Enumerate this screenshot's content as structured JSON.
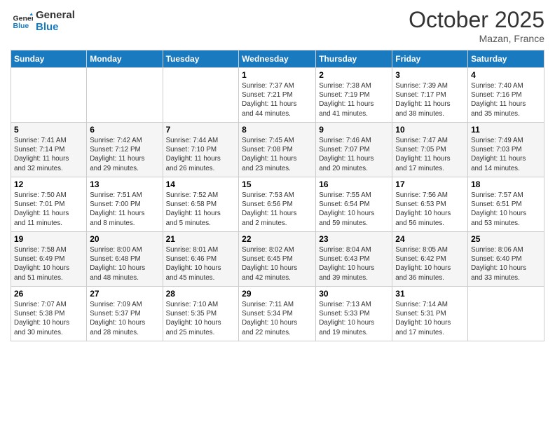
{
  "header": {
    "logo": {
      "line1": "General",
      "line2": "Blue"
    },
    "title": "October 2025",
    "location": "Mazan, France"
  },
  "weekdays": [
    "Sunday",
    "Monday",
    "Tuesday",
    "Wednesday",
    "Thursday",
    "Friday",
    "Saturday"
  ],
  "weeks": [
    [
      {
        "day": "",
        "info": ""
      },
      {
        "day": "",
        "info": ""
      },
      {
        "day": "",
        "info": ""
      },
      {
        "day": "1",
        "info": "Sunrise: 7:37 AM\nSunset: 7:21 PM\nDaylight: 11 hours\nand 44 minutes."
      },
      {
        "day": "2",
        "info": "Sunrise: 7:38 AM\nSunset: 7:19 PM\nDaylight: 11 hours\nand 41 minutes."
      },
      {
        "day": "3",
        "info": "Sunrise: 7:39 AM\nSunset: 7:17 PM\nDaylight: 11 hours\nand 38 minutes."
      },
      {
        "day": "4",
        "info": "Sunrise: 7:40 AM\nSunset: 7:16 PM\nDaylight: 11 hours\nand 35 minutes."
      }
    ],
    [
      {
        "day": "5",
        "info": "Sunrise: 7:41 AM\nSunset: 7:14 PM\nDaylight: 11 hours\nand 32 minutes."
      },
      {
        "day": "6",
        "info": "Sunrise: 7:42 AM\nSunset: 7:12 PM\nDaylight: 11 hours\nand 29 minutes."
      },
      {
        "day": "7",
        "info": "Sunrise: 7:44 AM\nSunset: 7:10 PM\nDaylight: 11 hours\nand 26 minutes."
      },
      {
        "day": "8",
        "info": "Sunrise: 7:45 AM\nSunset: 7:08 PM\nDaylight: 11 hours\nand 23 minutes."
      },
      {
        "day": "9",
        "info": "Sunrise: 7:46 AM\nSunset: 7:07 PM\nDaylight: 11 hours\nand 20 minutes."
      },
      {
        "day": "10",
        "info": "Sunrise: 7:47 AM\nSunset: 7:05 PM\nDaylight: 11 hours\nand 17 minutes."
      },
      {
        "day": "11",
        "info": "Sunrise: 7:49 AM\nSunset: 7:03 PM\nDaylight: 11 hours\nand 14 minutes."
      }
    ],
    [
      {
        "day": "12",
        "info": "Sunrise: 7:50 AM\nSunset: 7:01 PM\nDaylight: 11 hours\nand 11 minutes."
      },
      {
        "day": "13",
        "info": "Sunrise: 7:51 AM\nSunset: 7:00 PM\nDaylight: 11 hours\nand 8 minutes."
      },
      {
        "day": "14",
        "info": "Sunrise: 7:52 AM\nSunset: 6:58 PM\nDaylight: 11 hours\nand 5 minutes."
      },
      {
        "day": "15",
        "info": "Sunrise: 7:53 AM\nSunset: 6:56 PM\nDaylight: 11 hours\nand 2 minutes."
      },
      {
        "day": "16",
        "info": "Sunrise: 7:55 AM\nSunset: 6:54 PM\nDaylight: 10 hours\nand 59 minutes."
      },
      {
        "day": "17",
        "info": "Sunrise: 7:56 AM\nSunset: 6:53 PM\nDaylight: 10 hours\nand 56 minutes."
      },
      {
        "day": "18",
        "info": "Sunrise: 7:57 AM\nSunset: 6:51 PM\nDaylight: 10 hours\nand 53 minutes."
      }
    ],
    [
      {
        "day": "19",
        "info": "Sunrise: 7:58 AM\nSunset: 6:49 PM\nDaylight: 10 hours\nand 51 minutes."
      },
      {
        "day": "20",
        "info": "Sunrise: 8:00 AM\nSunset: 6:48 PM\nDaylight: 10 hours\nand 48 minutes."
      },
      {
        "day": "21",
        "info": "Sunrise: 8:01 AM\nSunset: 6:46 PM\nDaylight: 10 hours\nand 45 minutes."
      },
      {
        "day": "22",
        "info": "Sunrise: 8:02 AM\nSunset: 6:45 PM\nDaylight: 10 hours\nand 42 minutes."
      },
      {
        "day": "23",
        "info": "Sunrise: 8:04 AM\nSunset: 6:43 PM\nDaylight: 10 hours\nand 39 minutes."
      },
      {
        "day": "24",
        "info": "Sunrise: 8:05 AM\nSunset: 6:42 PM\nDaylight: 10 hours\nand 36 minutes."
      },
      {
        "day": "25",
        "info": "Sunrise: 8:06 AM\nSunset: 6:40 PM\nDaylight: 10 hours\nand 33 minutes."
      }
    ],
    [
      {
        "day": "26",
        "info": "Sunrise: 7:07 AM\nSunset: 5:38 PM\nDaylight: 10 hours\nand 30 minutes."
      },
      {
        "day": "27",
        "info": "Sunrise: 7:09 AM\nSunset: 5:37 PM\nDaylight: 10 hours\nand 28 minutes."
      },
      {
        "day": "28",
        "info": "Sunrise: 7:10 AM\nSunset: 5:35 PM\nDaylight: 10 hours\nand 25 minutes."
      },
      {
        "day": "29",
        "info": "Sunrise: 7:11 AM\nSunset: 5:34 PM\nDaylight: 10 hours\nand 22 minutes."
      },
      {
        "day": "30",
        "info": "Sunrise: 7:13 AM\nSunset: 5:33 PM\nDaylight: 10 hours\nand 19 minutes."
      },
      {
        "day": "31",
        "info": "Sunrise: 7:14 AM\nSunset: 5:31 PM\nDaylight: 10 hours\nand 17 minutes."
      },
      {
        "day": "",
        "info": ""
      }
    ]
  ]
}
